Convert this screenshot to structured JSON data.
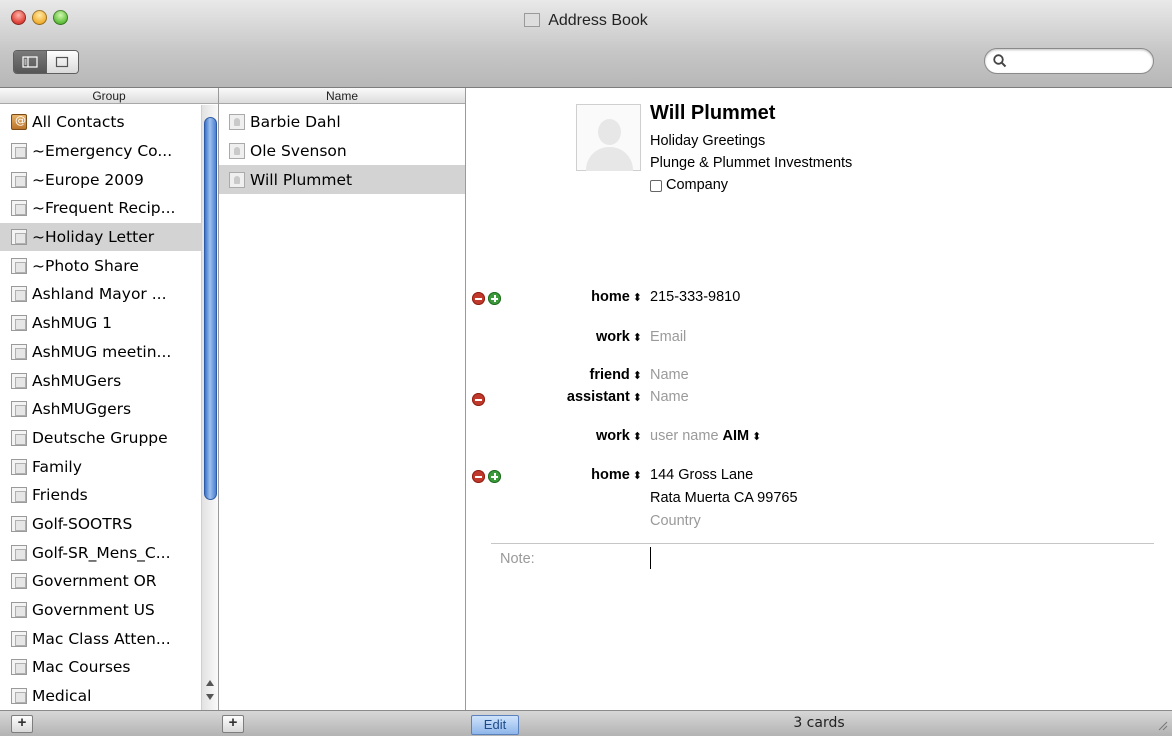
{
  "window": {
    "title": "Address Book"
  },
  "toolbar": {
    "search_placeholder": ""
  },
  "groups": {
    "header": "Group",
    "items": [
      "All Contacts",
      "~Emergency Co...",
      "~Europe 2009",
      "~Frequent Recip...",
      "~Holiday Letter",
      "~Photo Share",
      "Ashland Mayor ...",
      "AshMUG 1",
      "AshMUG meetin...",
      "AshMUGers",
      "AshMUGgers",
      "Deutsche Gruppe",
      "Family",
      "Friends",
      "Golf-SOOTRS",
      "Golf-SR_Mens_C...",
      "Government OR",
      "Government US",
      "Mac Class Atten...",
      "Mac Courses",
      "Medical"
    ],
    "selected": "~Holiday Letter"
  },
  "names": {
    "header": "Name",
    "items": [
      "Barbie Dahl",
      "Ole Svenson",
      "Will Plummet"
    ],
    "selected": "Will Plummet"
  },
  "card": {
    "name": "Will Plummet",
    "job_title": "Holiday Greetings",
    "company": "Plunge & Plummet Investments",
    "company_checkbox_label": "Company",
    "phone": {
      "label": "home",
      "value": "215-333-9810"
    },
    "email": {
      "label": "work",
      "placeholder": "Email"
    },
    "related1": {
      "label": "friend",
      "placeholder": "Name"
    },
    "related2": {
      "label": "assistant",
      "placeholder": "Name"
    },
    "im": {
      "label": "work",
      "placeholder": "user name",
      "service": "AIM"
    },
    "address": {
      "label": "home",
      "street": "144 Gross Lane",
      "city_line": "Rata Muerta CA 99765",
      "country_placeholder": "Country"
    },
    "note_label": "Note:"
  },
  "bottom": {
    "edit_label": "Edit",
    "count_text": "3 cards",
    "add_label": "+"
  },
  "icons": {
    "traffic_lights": [
      "close",
      "minimize",
      "zoom"
    ],
    "view_buttons": [
      "column-view-icon",
      "card-view-icon"
    ],
    "search": "magnifier-icon"
  }
}
